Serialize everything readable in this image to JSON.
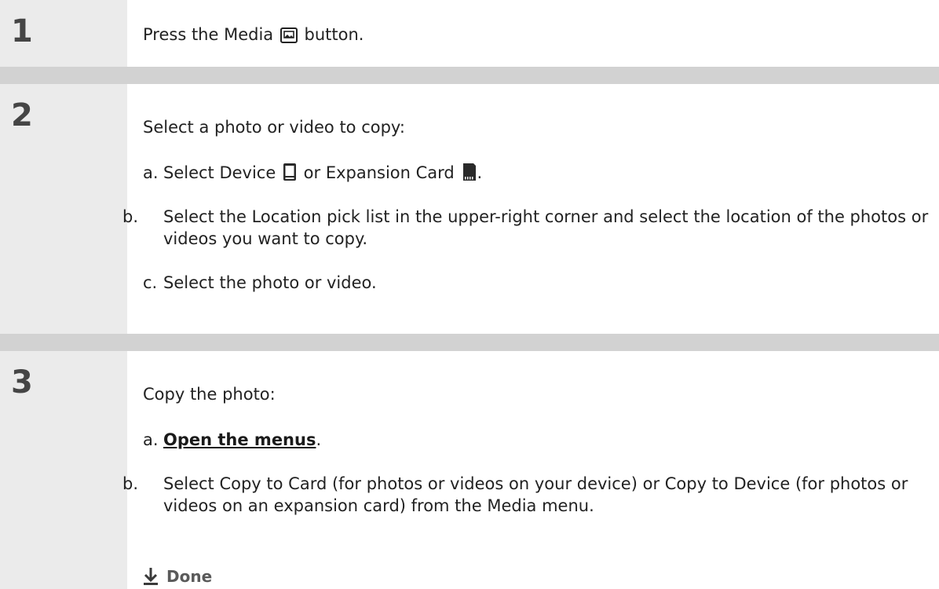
{
  "steps": [
    {
      "number": "1",
      "text_before": "Press the Media",
      "text_after": "button.",
      "icon": "media-button-icon"
    },
    {
      "number": "2",
      "intro": "Select a photo or video to copy:",
      "a": {
        "label": "a.",
        "text_before": "Select Device",
        "text_middle": "or Expansion Card",
        "text_after": ".",
        "icons": [
          "device-icon",
          "expansion-card-icon"
        ]
      },
      "b": {
        "label": "b.",
        "text": "Select the Location pick list in the upper-right corner and select the location of the photos or videos you want to copy."
      },
      "c": {
        "label": "c.",
        "text": "Select the photo or video."
      }
    },
    {
      "number": "3",
      "intro": "Copy the photo:",
      "a": {
        "label": "a.",
        "link": "Open the menus",
        "text_after": "."
      },
      "b": {
        "label": "b.",
        "text": "Select Copy to Card (for photos or videos on your device) or Copy to Device (for photos or videos on an expansion card) from the Media menu."
      }
    }
  ],
  "done": {
    "label": "Done",
    "icon": "down-arrow-icon"
  }
}
